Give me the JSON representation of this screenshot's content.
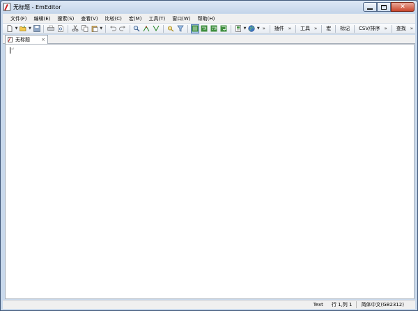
{
  "window": {
    "title": "无标题 - EmEditor"
  },
  "menu": [
    "文件(F)",
    "编辑(E)",
    "搜索(S)",
    "查看(V)",
    "比较(C)",
    "宏(M)",
    "工具(T)",
    "窗口(W)",
    "帮助(H)"
  ],
  "toolbar": {
    "plugins_label": "插件",
    "tools_label": "工具",
    "macros_label": "宏",
    "markers_label": "标记",
    "csv_label": "CSV/排序",
    "search_label": "查找",
    "chevron": "»"
  },
  "tabs": [
    {
      "label": "无标题",
      "close": "×"
    }
  ],
  "editor": {
    "eof_mark": "↵"
  },
  "status": {
    "mode": "Text",
    "position": "行 1,列 1",
    "encoding": "简体中文(GB2312)"
  },
  "colors": {
    "frame": "#c9d9ec",
    "close_button": "#c9462c",
    "highlight_button": "#3f8f3f"
  }
}
